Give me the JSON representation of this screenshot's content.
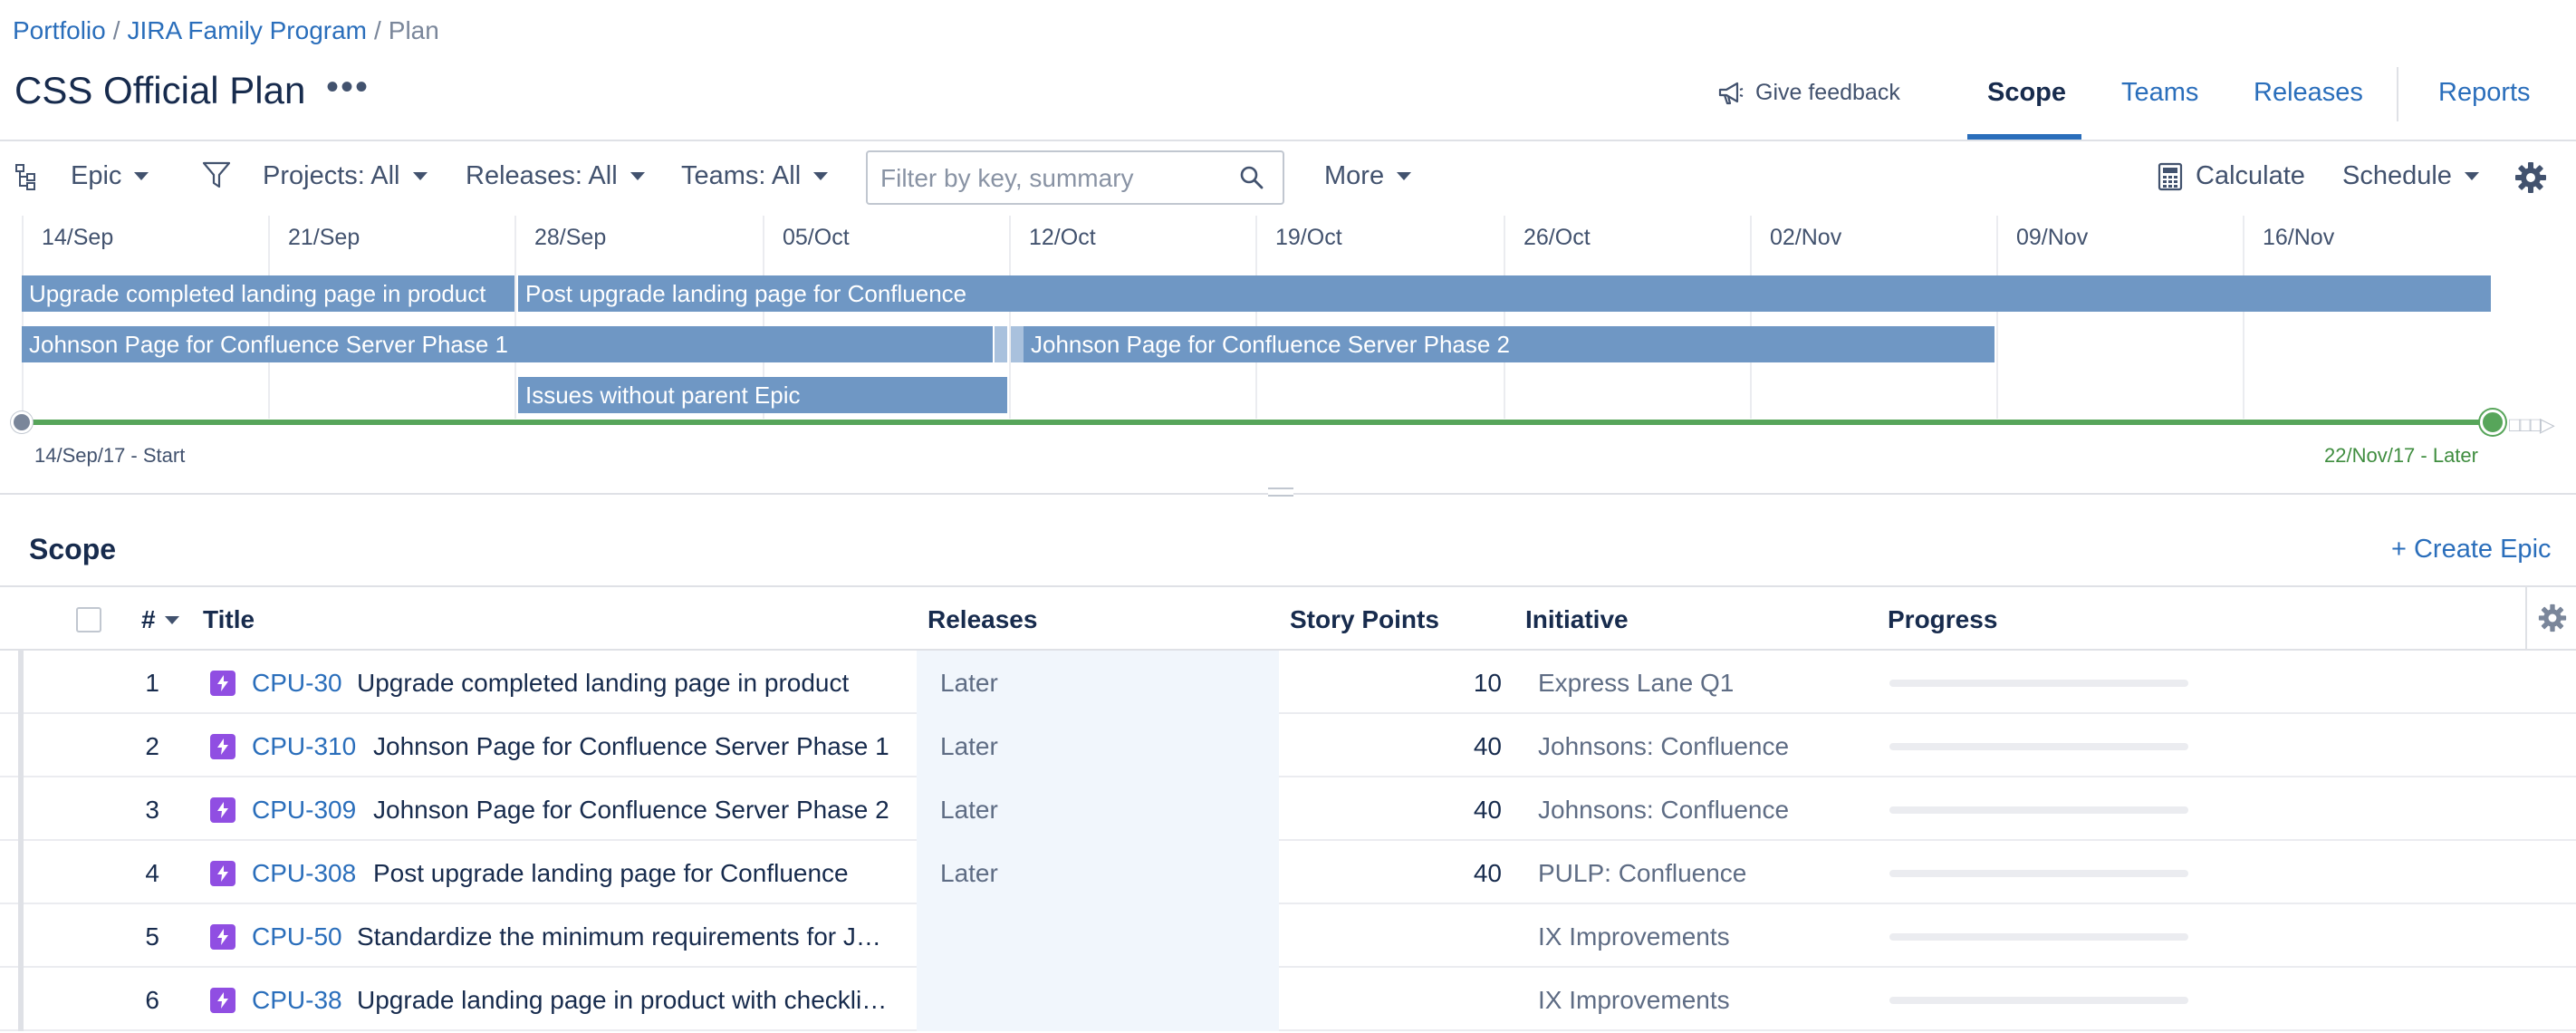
{
  "breadcrumb": {
    "portfolio": "Portfolio",
    "program": "JIRA Family Program",
    "current": "Plan",
    "separator": "/"
  },
  "plan_title": "CSS Official Plan",
  "more_actions_label": "•••",
  "feedback_label": "Give feedback",
  "nav_tabs": {
    "scope": "Scope",
    "teams": "Teams",
    "releases": "Releases",
    "reports": "Reports"
  },
  "toolbar": {
    "hierarchy_level": "Epic",
    "projects_filter": "Projects: All",
    "releases_filter": "Releases: All",
    "teams_filter": "Teams: All",
    "search_placeholder": "Filter by key, summary",
    "more": "More",
    "calculate": "Calculate",
    "schedule": "Schedule"
  },
  "timeline": {
    "dates": [
      "14/Sep",
      "21/Sep",
      "28/Sep",
      "05/Oct",
      "12/Oct",
      "19/Oct",
      "26/Oct",
      "02/Nov",
      "09/Nov",
      "16/Nov"
    ],
    "bars": {
      "upgrade_landing": "Upgrade completed landing page in product",
      "post_upgrade": "Post upgrade landing page for Confluence",
      "johnson_phase1": "Johnson Page for Confluence Server Phase 1",
      "johnson_phase2": "Johnson Page for Confluence Server Phase 2",
      "issues_without_parent": "Issues without parent Epic"
    },
    "range_start": "14/Sep/17 - Start",
    "range_end": "22/Nov/17 - Later"
  },
  "scope": {
    "title": "Scope",
    "create_epic": "+ Create Epic",
    "columns": {
      "rank": "#",
      "title": "Title",
      "releases": "Releases",
      "story_points": "Story Points",
      "initiative": "Initiative",
      "progress": "Progress"
    },
    "rows": [
      {
        "rank": "1",
        "key": "CPU-30",
        "summary": "Upgrade completed landing page in product",
        "release": "Later",
        "points": "10",
        "initiative": "Express Lane Q1",
        "progress": 0
      },
      {
        "rank": "2",
        "key": "CPU-310",
        "summary": "Johnson Page for Confluence Server Phase 1",
        "release": "Later",
        "points": "40",
        "initiative": "Johnsons: Confluence",
        "progress": 0
      },
      {
        "rank": "3",
        "key": "CPU-309",
        "summary": "Johnson Page for Confluence Server Phase 2",
        "release": "Later",
        "points": "40",
        "initiative": "Johnsons: Confluence",
        "progress": 0
      },
      {
        "rank": "4",
        "key": "CPU-308",
        "summary": "Post upgrade landing page for Confluence",
        "release": "Later",
        "points": "40",
        "initiative": "PULP: Confluence",
        "progress": 0
      },
      {
        "rank": "5",
        "key": "CPU-50",
        "summary": "Standardize the minimum requirements for J…",
        "release": "",
        "points": "",
        "initiative": "IX Improvements",
        "progress": 0
      },
      {
        "rank": "6",
        "key": "CPU-38",
        "summary": "Upgrade landing page in product with checkli…",
        "release": "",
        "points": "",
        "initiative": "IX Improvements",
        "progress": 0
      }
    ]
  },
  "icons": {
    "hierarchy": "hierarchy-icon",
    "filter": "filter-icon",
    "search": "search-icon",
    "megaphone": "megaphone-icon",
    "calculator": "calculator-icon",
    "settings": "gear-icon",
    "epic": "epic-lightning-icon"
  },
  "colors": {
    "link": "#2a6ebb",
    "bar": "#6f97c4",
    "range": "#57a55a",
    "epic": "#904ee2",
    "release_cell": "#f1f6fc"
  }
}
